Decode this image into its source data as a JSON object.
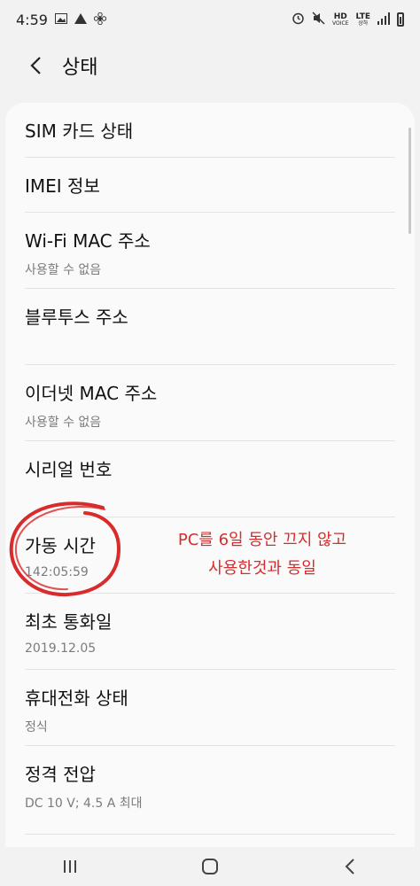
{
  "status_bar": {
    "time": "4:59",
    "left_icons": [
      "image-icon",
      "navigation-icon",
      "fan-icon"
    ],
    "right_labels": {
      "hd": "HD",
      "hd_sub": "VOICE",
      "lte": "LTE",
      "lte_sub": "상하"
    }
  },
  "header": {
    "title": "상태"
  },
  "items": [
    {
      "title": "SIM 카드 상태",
      "subtitle": ""
    },
    {
      "title": "IMEI 정보",
      "subtitle": ""
    },
    {
      "title": "Wi-Fi MAC 주소",
      "subtitle": "사용할 수 없음"
    },
    {
      "title": "블루투스 주소",
      "subtitle": ""
    },
    {
      "title": "이더넷 MAC 주소",
      "subtitle": "사용할 수 없음"
    },
    {
      "title": "시리얼 번호",
      "subtitle": ""
    },
    {
      "title": "가동 시간",
      "subtitle": "142:05:59"
    },
    {
      "title": "최초 통화일",
      "subtitle": "2019.12.05"
    },
    {
      "title": "휴대전화 상태",
      "subtitle": "정식"
    },
    {
      "title": "정격 전압",
      "subtitle": "DC 10 V; 4.5 A 최대"
    }
  ],
  "annotation": {
    "line1": "PC를 6일 동안 끄지 않고",
    "line2": "사용한것과 동일",
    "color": "#d82b2b"
  },
  "navbar": {
    "buttons": [
      "recents-icon",
      "home-icon",
      "back-icon"
    ]
  }
}
